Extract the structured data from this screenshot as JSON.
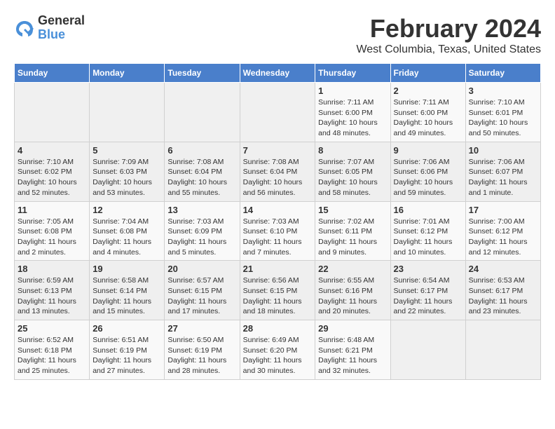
{
  "header": {
    "logo_general": "General",
    "logo_blue": "Blue",
    "month_year": "February 2024",
    "location": "West Columbia, Texas, United States"
  },
  "weekdays": [
    "Sunday",
    "Monday",
    "Tuesday",
    "Wednesday",
    "Thursday",
    "Friday",
    "Saturday"
  ],
  "weeks": [
    [
      {
        "day": "",
        "info": ""
      },
      {
        "day": "",
        "info": ""
      },
      {
        "day": "",
        "info": ""
      },
      {
        "day": "",
        "info": ""
      },
      {
        "day": "1",
        "info": "Sunrise: 7:11 AM\nSunset: 6:00 PM\nDaylight: 10 hours\nand 48 minutes."
      },
      {
        "day": "2",
        "info": "Sunrise: 7:11 AM\nSunset: 6:00 PM\nDaylight: 10 hours\nand 49 minutes."
      },
      {
        "day": "3",
        "info": "Sunrise: 7:10 AM\nSunset: 6:01 PM\nDaylight: 10 hours\nand 50 minutes."
      }
    ],
    [
      {
        "day": "4",
        "info": "Sunrise: 7:10 AM\nSunset: 6:02 PM\nDaylight: 10 hours\nand 52 minutes."
      },
      {
        "day": "5",
        "info": "Sunrise: 7:09 AM\nSunset: 6:03 PM\nDaylight: 10 hours\nand 53 minutes."
      },
      {
        "day": "6",
        "info": "Sunrise: 7:08 AM\nSunset: 6:04 PM\nDaylight: 10 hours\nand 55 minutes."
      },
      {
        "day": "7",
        "info": "Sunrise: 7:08 AM\nSunset: 6:04 PM\nDaylight: 10 hours\nand 56 minutes."
      },
      {
        "day": "8",
        "info": "Sunrise: 7:07 AM\nSunset: 6:05 PM\nDaylight: 10 hours\nand 58 minutes."
      },
      {
        "day": "9",
        "info": "Sunrise: 7:06 AM\nSunset: 6:06 PM\nDaylight: 10 hours\nand 59 minutes."
      },
      {
        "day": "10",
        "info": "Sunrise: 7:06 AM\nSunset: 6:07 PM\nDaylight: 11 hours\nand 1 minute."
      }
    ],
    [
      {
        "day": "11",
        "info": "Sunrise: 7:05 AM\nSunset: 6:08 PM\nDaylight: 11 hours\nand 2 minutes."
      },
      {
        "day": "12",
        "info": "Sunrise: 7:04 AM\nSunset: 6:08 PM\nDaylight: 11 hours\nand 4 minutes."
      },
      {
        "day": "13",
        "info": "Sunrise: 7:03 AM\nSunset: 6:09 PM\nDaylight: 11 hours\nand 5 minutes."
      },
      {
        "day": "14",
        "info": "Sunrise: 7:03 AM\nSunset: 6:10 PM\nDaylight: 11 hours\nand 7 minutes."
      },
      {
        "day": "15",
        "info": "Sunrise: 7:02 AM\nSunset: 6:11 PM\nDaylight: 11 hours\nand 9 minutes."
      },
      {
        "day": "16",
        "info": "Sunrise: 7:01 AM\nSunset: 6:12 PM\nDaylight: 11 hours\nand 10 minutes."
      },
      {
        "day": "17",
        "info": "Sunrise: 7:00 AM\nSunset: 6:12 PM\nDaylight: 11 hours\nand 12 minutes."
      }
    ],
    [
      {
        "day": "18",
        "info": "Sunrise: 6:59 AM\nSunset: 6:13 PM\nDaylight: 11 hours\nand 13 minutes."
      },
      {
        "day": "19",
        "info": "Sunrise: 6:58 AM\nSunset: 6:14 PM\nDaylight: 11 hours\nand 15 minutes."
      },
      {
        "day": "20",
        "info": "Sunrise: 6:57 AM\nSunset: 6:15 PM\nDaylight: 11 hours\nand 17 minutes."
      },
      {
        "day": "21",
        "info": "Sunrise: 6:56 AM\nSunset: 6:15 PM\nDaylight: 11 hours\nand 18 minutes."
      },
      {
        "day": "22",
        "info": "Sunrise: 6:55 AM\nSunset: 6:16 PM\nDaylight: 11 hours\nand 20 minutes."
      },
      {
        "day": "23",
        "info": "Sunrise: 6:54 AM\nSunset: 6:17 PM\nDaylight: 11 hours\nand 22 minutes."
      },
      {
        "day": "24",
        "info": "Sunrise: 6:53 AM\nSunset: 6:17 PM\nDaylight: 11 hours\nand 23 minutes."
      }
    ],
    [
      {
        "day": "25",
        "info": "Sunrise: 6:52 AM\nSunset: 6:18 PM\nDaylight: 11 hours\nand 25 minutes."
      },
      {
        "day": "26",
        "info": "Sunrise: 6:51 AM\nSunset: 6:19 PM\nDaylight: 11 hours\nand 27 minutes."
      },
      {
        "day": "27",
        "info": "Sunrise: 6:50 AM\nSunset: 6:19 PM\nDaylight: 11 hours\nand 28 minutes."
      },
      {
        "day": "28",
        "info": "Sunrise: 6:49 AM\nSunset: 6:20 PM\nDaylight: 11 hours\nand 30 minutes."
      },
      {
        "day": "29",
        "info": "Sunrise: 6:48 AM\nSunset: 6:21 PM\nDaylight: 11 hours\nand 32 minutes."
      },
      {
        "day": "",
        "info": ""
      },
      {
        "day": "",
        "info": ""
      }
    ]
  ]
}
